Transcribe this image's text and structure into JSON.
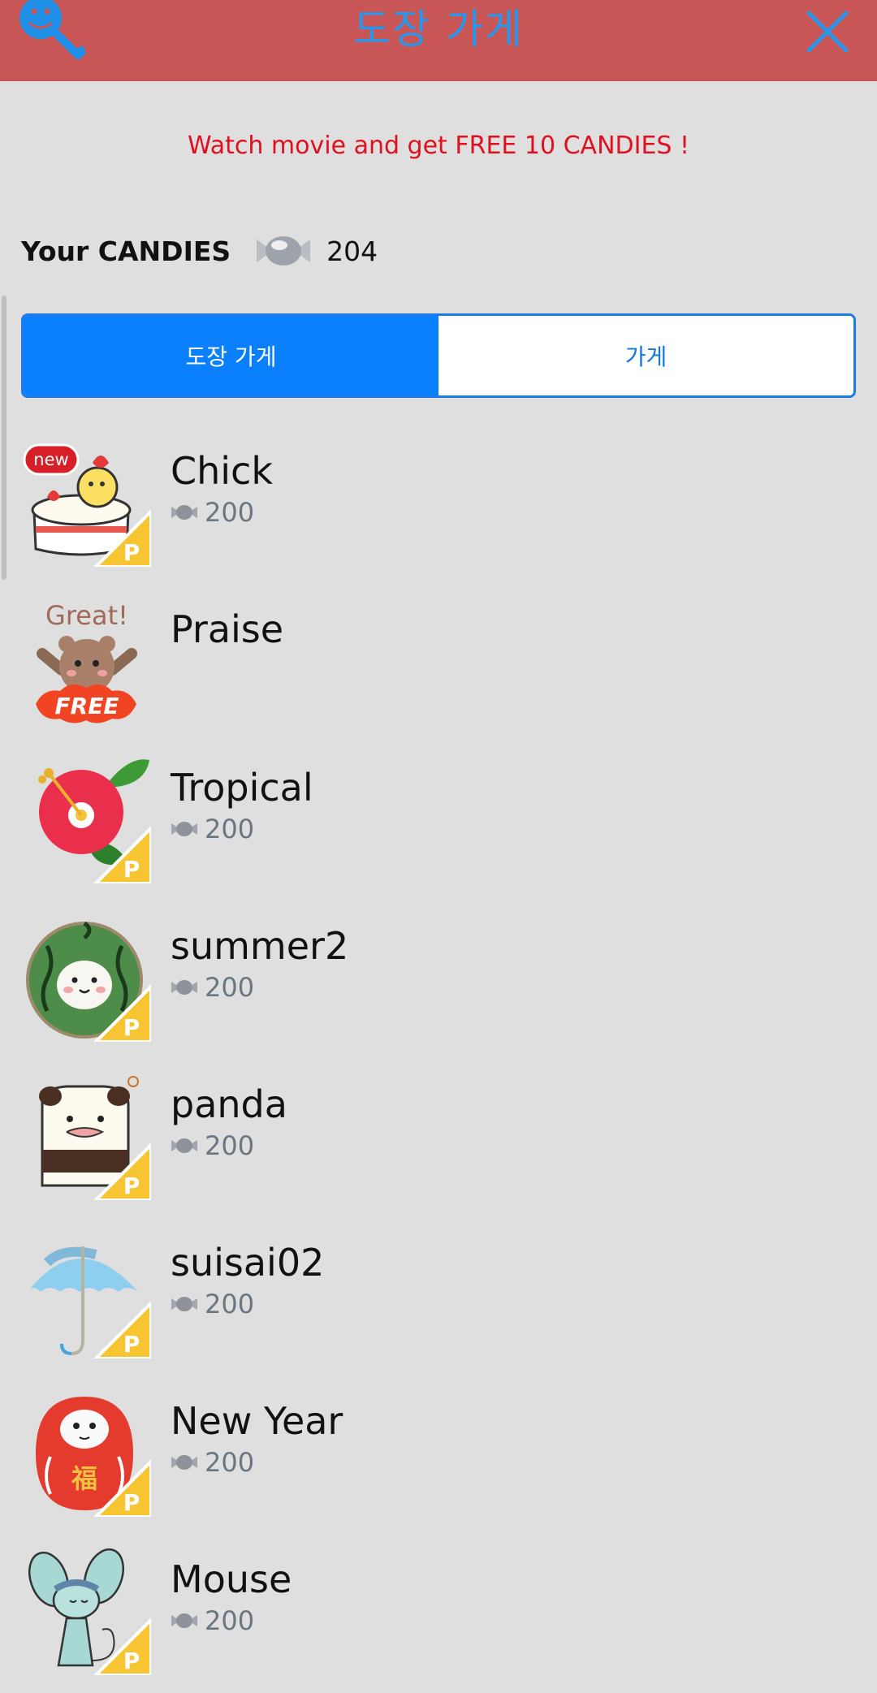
{
  "header": {
    "title": "도장 가게",
    "logo_icon": "smiley-wrench-icon",
    "close_icon": "close-icon"
  },
  "promo": {
    "text": "Watch movie and get FREE 10 CANDIES !"
  },
  "candies": {
    "label": "Your CANDIES",
    "count": "204",
    "icon": "candy-icon"
  },
  "tabs": [
    {
      "label": "도장 가게",
      "active": true
    },
    {
      "label": "가게",
      "active": false
    }
  ],
  "items": [
    {
      "name": "Chick",
      "price": "200",
      "badge": "new",
      "tag": "P"
    },
    {
      "name": "Praise",
      "price": "",
      "badge": "FREE",
      "thumb_text": "Great!"
    },
    {
      "name": "Tropical",
      "price": "200",
      "tag": "P"
    },
    {
      "name": "summer2",
      "price": "200",
      "tag": "P"
    },
    {
      "name": "panda",
      "price": "200",
      "tag": "P"
    },
    {
      "name": "suisai02",
      "price": "200",
      "tag": "P"
    },
    {
      "name": "New Year",
      "price": "200",
      "tag": "P",
      "thumb_text": "福"
    },
    {
      "name": "Mouse",
      "price": "200",
      "tag": "P"
    }
  ],
  "colors": {
    "header_bg": "#c95656",
    "title": "#2a96ea",
    "promo": "#e0101e",
    "tab_active": "#0a80ff",
    "tab_inactive_text": "#1177e3",
    "price_text": "#6a7682",
    "page_bg": "#dfdfdf"
  }
}
